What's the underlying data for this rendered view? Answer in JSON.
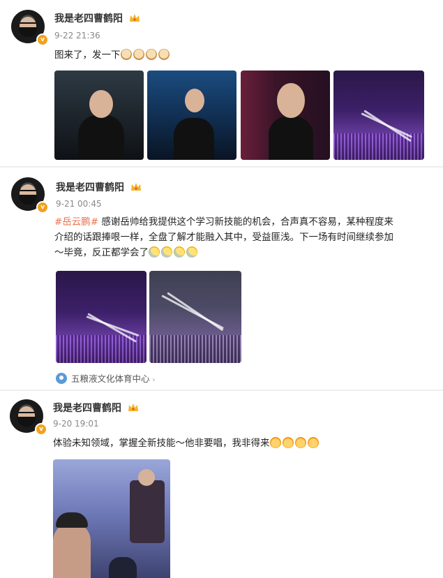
{
  "posts": [
    {
      "author": "我是老四曹鹤阳",
      "time": "9-22 21:36",
      "text": "图来了，发一下",
      "emojis": [
        "doge",
        "doge",
        "doge",
        "doge"
      ]
    },
    {
      "author": "我是老四曹鹤阳",
      "time": "9-21 00:45",
      "hashtag": "#岳云鹏#",
      "line1": " 感谢岳帅给我提供这个学习新技能的机会，合声真不容易，某种程度来",
      "line2": "介绍的话跟捧哏一样，全盘了解才能融入其中，受益匪浅。下一场有时间继续参加",
      "line3": "～毕竟，反正都学会了",
      "emojis": [
        "sweat",
        "sweat",
        "sweat",
        "sweat"
      ],
      "location": "五粮液文化体育中心"
    },
    {
      "author": "我是老四曹鹤阳",
      "time": "9-20 19:01",
      "text": "体验未知领域，掌握全新技能～他非要唱，我非得来",
      "emojis": [
        "angry",
        "angry",
        "angry",
        "angry"
      ]
    }
  ],
  "icons": {
    "verified": "v-badge-icon",
    "crown": "crown-icon",
    "location": "location-pin-icon"
  },
  "colors": {
    "hashtag": "#eb7350",
    "badge": "#f3a11d",
    "location_pin": "#5b9bd5"
  }
}
